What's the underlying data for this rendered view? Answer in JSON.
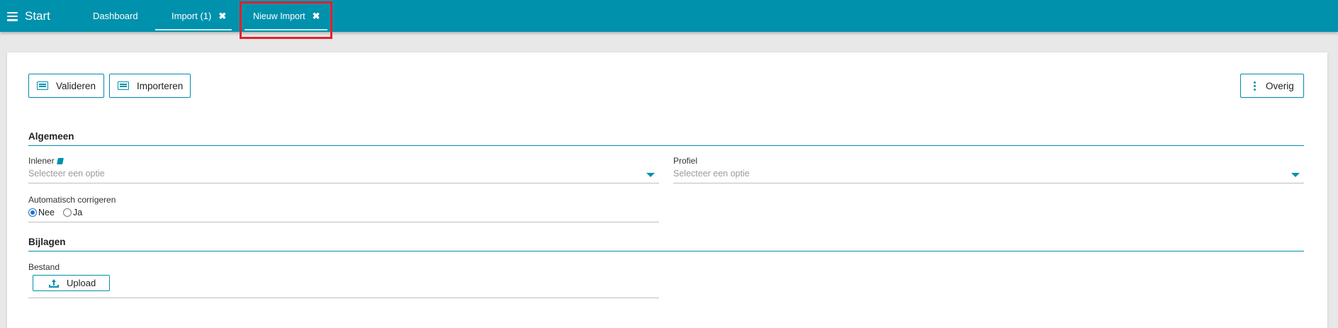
{
  "topbar": {
    "start_label": "Start",
    "tabs": [
      {
        "label": "Dashboard"
      },
      {
        "label": "Import (1)",
        "close": "✖"
      },
      {
        "label": "Nieuw Import",
        "close": "✖"
      }
    ]
  },
  "toolbar": {
    "validate_label": "Valideren",
    "import_label": "Importeren",
    "more_label": "Overig"
  },
  "sections": {
    "general_title": "Algemeen",
    "attachments_title": "Bijlagen"
  },
  "fields": {
    "inlener": {
      "label": "Inlener",
      "placeholder": "Selecteer een optie"
    },
    "profiel": {
      "label": "Profiel",
      "placeholder": "Selecteer een optie"
    },
    "auto_correct": {
      "label": "Automatisch corrigeren",
      "options": [
        {
          "label": "Nee",
          "checked": true
        },
        {
          "label": "Ja",
          "checked": false
        }
      ]
    },
    "bestand": {
      "label": "Bestand",
      "upload_label": "Upload"
    }
  },
  "colors": {
    "accent": "#0091ad",
    "highlight": "#e3222b",
    "radio_checked": "#1a73c7"
  }
}
